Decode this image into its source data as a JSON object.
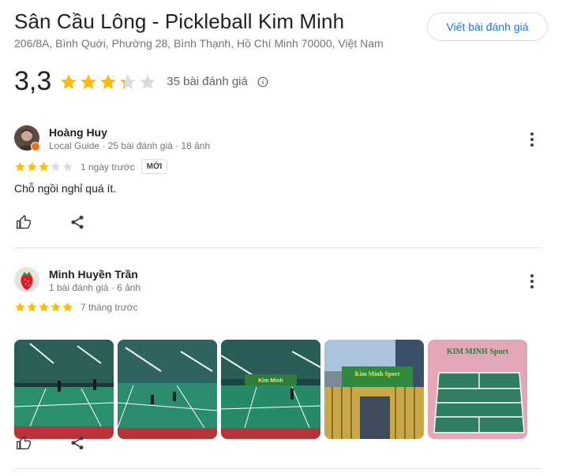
{
  "place": {
    "title": "Sân Cầu Lông - Pickleball Kim Minh",
    "address": "206/8A, Bình Quới, Phường 28, Bình Thạnh, Hồ Chí Minh 70000, Việt Nam",
    "write_review_label": "Viết bài đánh giá",
    "rating": "3,3",
    "rating_value": 3.3,
    "review_count": "35 bài đánh giá"
  },
  "colors": {
    "star": "#fbbc04",
    "star_empty": "#dadce0",
    "accent": "#1a73e8",
    "local_guide_badge": "#e8710a"
  },
  "reviews": [
    {
      "name": "Hoàng Huy",
      "meta": "Local Guide · 25 bài đánh giá · 18 ảnh",
      "stars": 3,
      "time": "1 ngày trước",
      "badge": "MỚI",
      "text": "Chỗ ngồi nghỉ quá ít."
    },
    {
      "name": "Minh Huyền Trần",
      "meta": "1 bài đánh giá · 6 ảnh",
      "stars": 5,
      "time": "7 tháng trước",
      "photos": [
        {
          "name": "court-photo-1",
          "sign_text": ""
        },
        {
          "name": "court-photo-2",
          "sign_text": ""
        },
        {
          "name": "court-photo-3",
          "sign_text": "Kim Minh"
        },
        {
          "name": "entrance-sign-photo",
          "sign_text": "Kim Minh Sport"
        },
        {
          "name": "court-sign-photo",
          "sign_text": "KIM MINH Sport"
        }
      ]
    }
  ],
  "icons": {
    "info": "info-icon",
    "more": "more-vert-icon",
    "like": "thumb-up-icon",
    "share": "share-icon"
  }
}
